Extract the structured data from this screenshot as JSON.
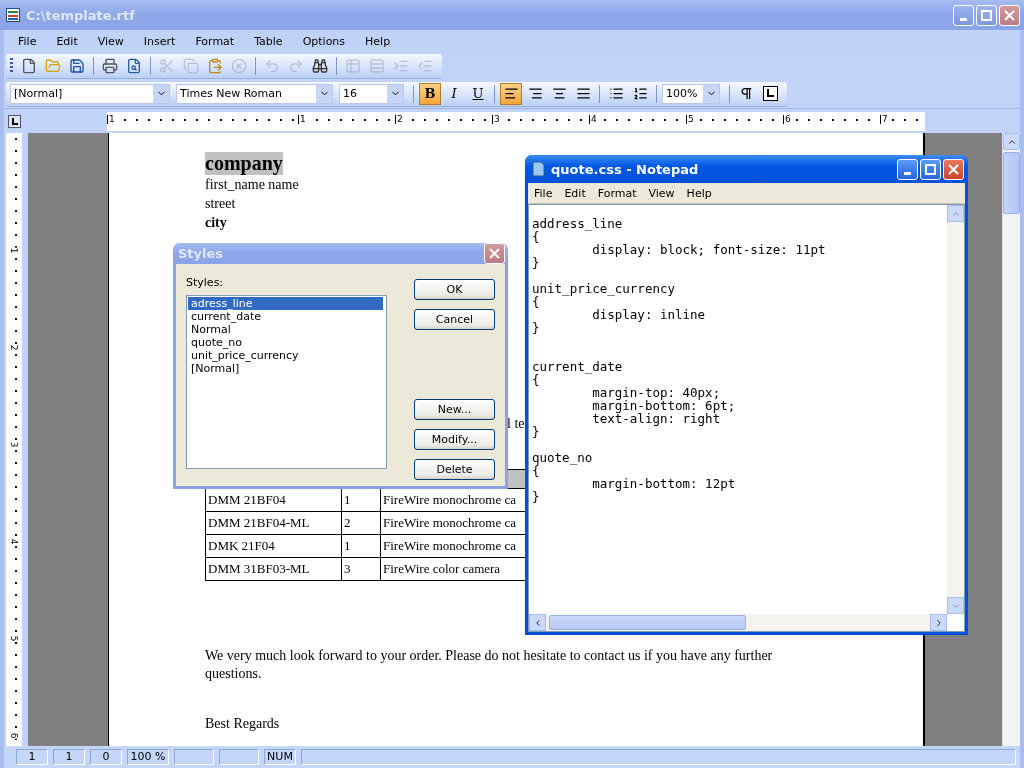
{
  "window": {
    "title": "C:\\template.rtf"
  },
  "menu": [
    "File",
    "Edit",
    "View",
    "Insert",
    "Format",
    "Table",
    "Options",
    "Help"
  ],
  "toolbar": [
    [
      {
        "kind": "new",
        "disabled": false
      },
      {
        "kind": "open",
        "disabled": false
      },
      {
        "kind": "save",
        "disabled": false
      }
    ],
    [
      {
        "kind": "print",
        "disabled": false
      },
      {
        "kind": "preview",
        "disabled": false
      }
    ],
    [
      {
        "kind": "cut",
        "disabled": true
      },
      {
        "kind": "copy",
        "disabled": true
      },
      {
        "kind": "paste",
        "disabled": false
      },
      {
        "kind": "delete",
        "disabled": true
      }
    ],
    [
      {
        "kind": "undo",
        "disabled": true
      },
      {
        "kind": "redo",
        "disabled": true
      },
      {
        "kind": "find",
        "disabled": false
      }
    ],
    [
      {
        "kind": "table_insert",
        "disabled": true
      },
      {
        "kind": "table_rows",
        "disabled": true
      },
      {
        "kind": "indent",
        "disabled": true
      },
      {
        "kind": "outdent",
        "disabled": true
      }
    ]
  ],
  "format_bar": {
    "style": "[Normal]",
    "font": "Times New Roman",
    "size": "16",
    "text_buttons": [
      {
        "kind": "bold",
        "label": "B",
        "selected": true
      },
      {
        "kind": "italic",
        "label": "I",
        "selected": false
      },
      {
        "kind": "underline",
        "label": "U",
        "selected": false
      }
    ],
    "align_buttons": [
      {
        "kind": "left",
        "selected": true
      },
      {
        "kind": "right",
        "selected": false
      },
      {
        "kind": "center",
        "selected": false
      },
      {
        "kind": "justify",
        "selected": false
      }
    ],
    "zoom": "100%"
  },
  "ruler": {
    "labels": [
      "1",
      "1",
      "2",
      "3",
      "4",
      "5",
      "6",
      "7"
    ]
  },
  "vertical_ruler": {
    "labels": [
      "1",
      "2",
      "3",
      "4",
      "5",
      "6"
    ]
  },
  "document": {
    "heading": "company",
    "address_lines": [
      {
        "text": "first_name name",
        "bold": false
      },
      {
        "text": "street",
        "bold": false
      },
      {
        "text": "city",
        "bold": true
      }
    ],
    "fragment": "l te",
    "table": {
      "rows": [
        [
          "DMM 21BF04",
          "1",
          "FireWire monochrome ca"
        ],
        [
          "DMM 21BF04-ML",
          "2",
          "FireWire monochrome ca"
        ],
        [
          "DMK 21F04",
          "1",
          "FireWire monochrome ca"
        ],
        [
          "DMM 31BF03-ML",
          "3",
          "FireWire color camera"
        ]
      ]
    },
    "paragraph": "We very much look forward to your order. Please do not hesitate to contact us if you have any further questions.",
    "closing": "Best Regards"
  },
  "styles_dialog": {
    "title": "Styles",
    "list_label": "Styles:",
    "items": [
      {
        "label": "adress_line",
        "selected": true
      },
      {
        "label": "current_date",
        "selected": false
      },
      {
        "label": "Normal",
        "selected": false
      },
      {
        "label": "quote_no",
        "selected": false
      },
      {
        "label": "unit_price_currency",
        "selected": false
      },
      {
        "label": "[Normal]",
        "selected": false
      }
    ],
    "top_buttons": [
      "OK",
      "Cancel"
    ],
    "bottom_buttons": [
      "New...",
      "Modify...",
      "Delete"
    ]
  },
  "notepad": {
    "title": "quote.css - Notepad",
    "menu": [
      "File",
      "Edit",
      "Format",
      "View",
      "Help"
    ],
    "text": "address_line\n{\n\tdisplay: block; font-size: 11pt\n}\n\nunit_price_currency\n{\n\tdisplay: inline\n}\n\n\ncurrent_date\n{\n\tmargin-top: 40px;\n\tmargin-bottom: 6pt;\n\ttext-align: right\n}\n\nquote_no\n{\n\tmargin-bottom: 12pt\n}"
  },
  "status_bar": {
    "panels": [
      "1",
      "1",
      "0",
      "100 %",
      "NUM"
    ]
  }
}
